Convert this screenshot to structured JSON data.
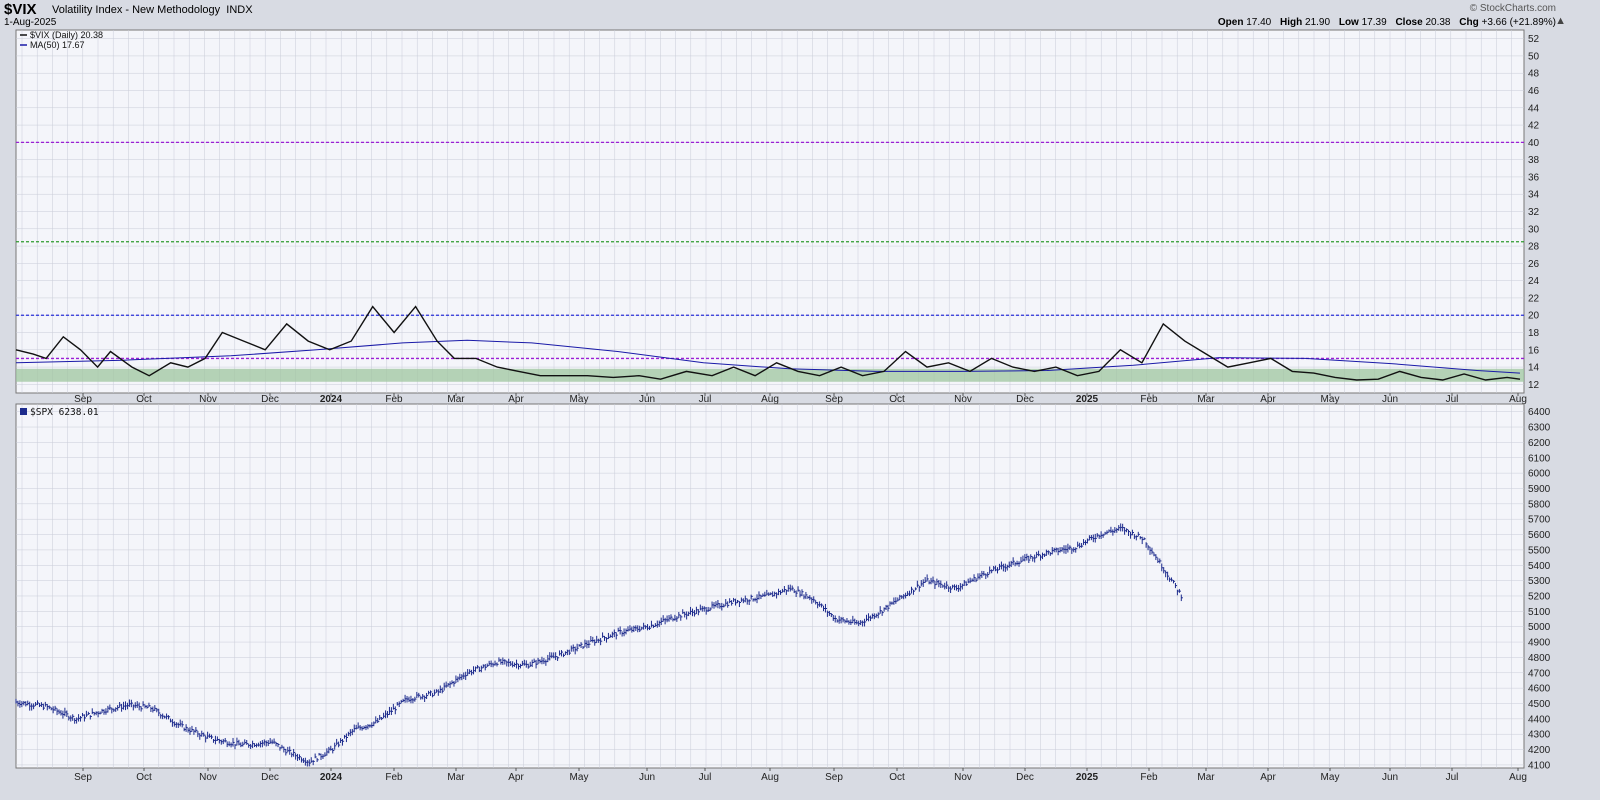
{
  "header": {
    "symbol": "$VIX",
    "name": "Volatility Index - New Methodology",
    "exchange": "INDX",
    "date": "1-Aug-2025",
    "brand": "© StockCharts.com",
    "open_label": "Open",
    "open": "17.40",
    "high_label": "High",
    "high": "21.90",
    "low_label": "Low",
    "low": "17.39",
    "close_label": "Close",
    "close": "20.38",
    "chg_label": "Chg",
    "chg": "+3.66 (+21.89%)",
    "arrow": "▲"
  },
  "colors": {
    "panel_bg": "#f4f5fa",
    "grid": "#c9ccd8",
    "vix_line": "#111111",
    "ma_line": "#1a1aa8",
    "spx_bars": "#1c2a8c",
    "line_40": "#9b1fd6",
    "line_28": "#2e9a2e",
    "line_20": "#2a30d8",
    "line_15": "#9b1fd6",
    "zone_fill": "#9fc59f"
  },
  "chart_data": [
    {
      "type": "line",
      "title": "$VIX Volatility Index - New Methodology INDX",
      "legend": [
        {
          "label": "$VIX (Daily) 20.38",
          "color": "#111111"
        },
        {
          "label": "MA(50) 17.67",
          "color": "#1a1aa8"
        }
      ],
      "x_ticks": [
        "Sep",
        "Oct",
        "Nov",
        "Dec",
        "2024",
        "Feb",
        "Mar",
        "Apr",
        "May",
        "Jun",
        "Jul",
        "Aug",
        "Sep",
        "Oct",
        "Nov",
        "Dec",
        "2025",
        "Feb",
        "Mar",
        "Apr",
        "May",
        "Jun",
        "Jul",
        "Aug"
      ],
      "y_ticks": [
        12,
        14,
        16,
        18,
        20,
        22,
        24,
        26,
        28,
        30,
        32,
        34,
        36,
        38,
        40,
        42,
        44,
        46,
        48,
        50,
        52
      ],
      "ylim": [
        11,
        53
      ],
      "xlim": [
        0,
        700
      ],
      "horizontal_lines": [
        {
          "value": 40,
          "style": "dashed",
          "color": "#9b1fd6"
        },
        {
          "value": 28.5,
          "style": "dashed",
          "color": "#2e9a2e"
        },
        {
          "value": 20,
          "style": "dashed",
          "color": "#2a30d8"
        },
        {
          "value": 15,
          "style": "dashed",
          "color": "#9b1fd6"
        }
      ],
      "zone": {
        "from": 12.3,
        "to": 13.8,
        "color": "#9fc59f"
      },
      "series": [
        {
          "name": "$VIX (Daily)",
          "points": [
            [
              0,
              16
            ],
            [
              8,
              15.5
            ],
            [
              14,
              15
            ],
            [
              22,
              17.5
            ],
            [
              30,
              16
            ],
            [
              38,
              14
            ],
            [
              44,
              15.8
            ],
            [
              54,
              14
            ],
            [
              62,
              13
            ],
            [
              72,
              14.5
            ],
            [
              80,
              14
            ],
            [
              88,
              15
            ],
            [
              96,
              18
            ],
            [
              106,
              17
            ],
            [
              116,
              16
            ],
            [
              126,
              19
            ],
            [
              136,
              17
            ],
            [
              146,
              16
            ],
            [
              156,
              17
            ],
            [
              166,
              21
            ],
            [
              176,
              18
            ],
            [
              186,
              21
            ],
            [
              196,
              17
            ],
            [
              204,
              15
            ],
            [
              214,
              15
            ],
            [
              224,
              14
            ],
            [
              234,
              13.5
            ],
            [
              244,
              13
            ],
            [
              254,
              13
            ],
            [
              266,
              13
            ],
            [
              278,
              12.8
            ],
            [
              290,
              13
            ],
            [
              300,
              12.6
            ],
            [
              312,
              13.5
            ],
            [
              324,
              13
            ],
            [
              334,
              14
            ],
            [
              344,
              13
            ],
            [
              354,
              14.5
            ],
            [
              364,
              13.5
            ],
            [
              374,
              13
            ],
            [
              384,
              14
            ],
            [
              394,
              13
            ],
            [
              404,
              13.5
            ],
            [
              414,
              15.8
            ],
            [
              424,
              14
            ],
            [
              434,
              14.5
            ],
            [
              444,
              13.5
            ],
            [
              454,
              15
            ],
            [
              464,
              14
            ],
            [
              474,
              13.5
            ],
            [
              484,
              14
            ],
            [
              494,
              13
            ],
            [
              504,
              13.5
            ],
            [
              514,
              16
            ],
            [
              524,
              14.5
            ],
            [
              534,
              19
            ],
            [
              544,
              17
            ],
            [
              554,
              15.5
            ],
            [
              564,
              14
            ],
            [
              574,
              14.5
            ],
            [
              584,
              15
            ],
            [
              594,
              13.5
            ],
            [
              604,
              13.3
            ],
            [
              614,
              12.8
            ],
            [
              624,
              12.5
            ],
            [
              634,
              12.6
            ],
            [
              644,
              13.5
            ],
            [
              654,
              12.8
            ],
            [
              664,
              12.5
            ],
            [
              674,
              13.2
            ],
            [
              684,
              12.5
            ],
            [
              694,
              12.8
            ],
            [
              700,
              12.6
            ]
          ]
        },
        {
          "name": "MA(50)",
          "points": [
            [
              0,
              14.5
            ],
            [
              50,
              14.8
            ],
            [
              100,
              15.3
            ],
            [
              140,
              16
            ],
            [
              180,
              16.8
            ],
            [
              210,
              17.1
            ],
            [
              240,
              16.8
            ],
            [
              280,
              15.8
            ],
            [
              320,
              14.5
            ],
            [
              360,
              13.8
            ],
            [
              400,
              13.5
            ],
            [
              440,
              13.5
            ],
            [
              480,
              13.6
            ],
            [
              520,
              14.2
            ],
            [
              560,
              15.1
            ],
            [
              600,
              15
            ],
            [
              640,
              14.4
            ],
            [
              680,
              13.6
            ],
            [
              700,
              13.3
            ]
          ]
        }
      ]
    },
    {
      "type": "bar",
      "title": "$SPX 6238.01",
      "legend": [
        {
          "label": "$SPX 6238.01",
          "color": "#1c2a8c"
        }
      ],
      "y_ticks": [
        4100,
        4200,
        4300,
        4400,
        4500,
        4600,
        4700,
        4800,
        4900,
        5000,
        5100,
        5200,
        5300,
        5400,
        5500,
        5600,
        5700,
        5800,
        5900,
        6000,
        6100,
        6200,
        6300,
        6400
      ],
      "ylim": [
        4080,
        6450
      ],
      "xlim": [
        0,
        1000
      ],
      "ohlc_style": "hlc bars",
      "series": [
        {
          "name": "$SPX",
          "points": [
            [
              0,
              4510
            ],
            [
              20,
              4480
            ],
            [
              40,
              4400
            ],
            [
              60,
              4460
            ],
            [
              75,
              4490
            ],
            [
              90,
              4470
            ],
            [
              110,
              4350
            ],
            [
              130,
              4270
            ],
            [
              150,
              4230
            ],
            [
              170,
              4250
            ],
            [
              180,
              4190
            ],
            [
              195,
              4120
            ],
            [
              210,
              4200
            ],
            [
              225,
              4330
            ],
            [
              240,
              4380
            ],
            [
              260,
              4530
            ],
            [
              280,
              4570
            ],
            [
              300,
              4700
            ],
            [
              320,
              4770
            ],
            [
              340,
              4750
            ],
            [
              360,
              4810
            ],
            [
              380,
              4890
            ],
            [
              400,
              4960
            ],
            [
              420,
              5000
            ],
            [
              440,
              5070
            ],
            [
              460,
              5120
            ],
            [
              480,
              5170
            ],
            [
              500,
              5200
            ],
            [
              515,
              5250
            ],
            [
              530,
              5180
            ],
            [
              545,
              5050
            ],
            [
              560,
              5020
            ],
            [
              575,
              5100
            ],
            [
              590,
              5200
            ],
            [
              605,
              5300
            ],
            [
              625,
              5250
            ],
            [
              645,
              5350
            ],
            [
              665,
              5420
            ],
            [
              685,
              5480
            ],
            [
              705,
              5520
            ],
            [
              720,
              5600
            ],
            [
              735,
              5640
            ],
            [
              750,
              5570
            ],
            [
              765,
              5350
            ],
            [
              775,
              5200
            ]
          ]
        }
      ]
    }
  ],
  "x_axis_bottom": [
    "Sep",
    "Oct",
    "Nov",
    "Dec",
    "2024",
    "Feb",
    "Mar",
    "Apr",
    "May",
    "Jun",
    "Jul",
    "Aug",
    "Sep",
    "Oct",
    "Nov",
    "Dec",
    "2025",
    "Feb",
    "Mar",
    "Apr",
    "May",
    "Jun",
    "Jul",
    "Aug"
  ]
}
